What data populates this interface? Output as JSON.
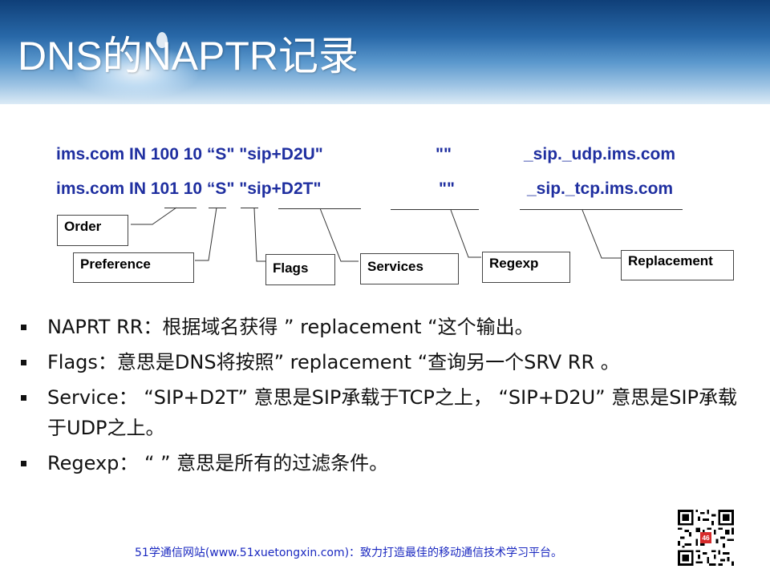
{
  "title": "DNS的NAPTR记录",
  "records": [
    {
      "domain": "ims.com IN 100 10 “S\" \"sip+D2U\"",
      "regexp": "\"\"",
      "replacement": "_sip._udp.ims.com"
    },
    {
      "domain": "ims.com IN 101 10 “S\" \"sip+D2T\"",
      "regexp": "\"\"",
      "replacement": "_sip._tcp.ims.com"
    }
  ],
  "labels": {
    "order": "Order",
    "preference": "Preference",
    "flags": "Flags",
    "services": "Services",
    "regexp": "Regexp",
    "replacement": "Replacement"
  },
  "bullets": [
    "NAPRT RR：根据域名获得 ” replacement “这个输出。",
    "Flags：意思是DNS将按照” replacement “查询另一个SRV RR 。",
    "Service： “SIP+D2T” 意思是SIP承载于TCP之上， “SIP+D2U” 意思是SIP承载于UDP之上。",
    "Regexp： “ ” 意思是所有的过滤条件。"
  ],
  "footer": "51学通信网站(www.51xuetongxin.com)：致力打造最佳的移动通信技术学习平台。",
  "colors": {
    "record_text": "#1f2fa0",
    "footer_text": "#1a28c0",
    "header_dark": "#0f3f78",
    "header_light": "#dcebf6"
  },
  "qr_badge": "46"
}
